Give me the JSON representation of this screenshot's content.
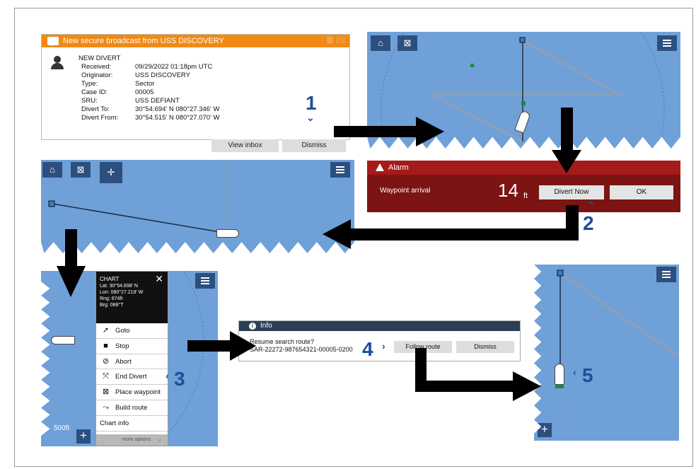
{
  "message": {
    "header": "New secure broadcast from USS DISCOVERY",
    "title": "NEW DIVERT",
    "rows": [
      {
        "label": "Received:",
        "value": "09/29/2022 01:18pm UTC"
      },
      {
        "label": "Originator:",
        "value": "USS DISCOVERY"
      },
      {
        "label": "Type:",
        "value": "Sector"
      },
      {
        "label": "Case ID:",
        "value": "00005"
      },
      {
        "label": "SRU:",
        "value": "USS DEFIANT"
      },
      {
        "label": "Divert To:",
        "value": "30°54.694' N 080°27.346' W"
      },
      {
        "label": "Divert From:",
        "value": "30°54.515' N 080°27.070' W"
      }
    ],
    "view_inbox": "View inbox",
    "dismiss": "Dismiss"
  },
  "alarm": {
    "title": "Alarm",
    "label": "Waypoint arrival",
    "value": "14",
    "unit": "ft",
    "divert_now": "Divert Now",
    "ok": "OK"
  },
  "chart_menu": {
    "title": "CHART",
    "lat": "Lat: 30°54.698' N",
    "lon": "Lon: 080°27.218' W",
    "rng": "Rng: 674ft",
    "brg": "Brg: 088°T",
    "items": [
      "Goto",
      "Stop",
      "Abort",
      "End Divert",
      "Place waypoint",
      "Build route",
      "Chart info"
    ],
    "more": "more options"
  },
  "info": {
    "title": "Info",
    "question": "Resume search route?",
    "route": "SAR-22272-987654321-00005-0200",
    "follow": "Follow route",
    "dismiss": "Dismiss"
  },
  "map": {
    "scale": "500ft"
  },
  "steps": [
    "1",
    "2",
    "3",
    "4",
    "5"
  ],
  "colors": {
    "water": "#6fa0d8",
    "accent": "#1d4f9a",
    "alarm": "#7c1414",
    "header_orange": "#f08a14"
  }
}
